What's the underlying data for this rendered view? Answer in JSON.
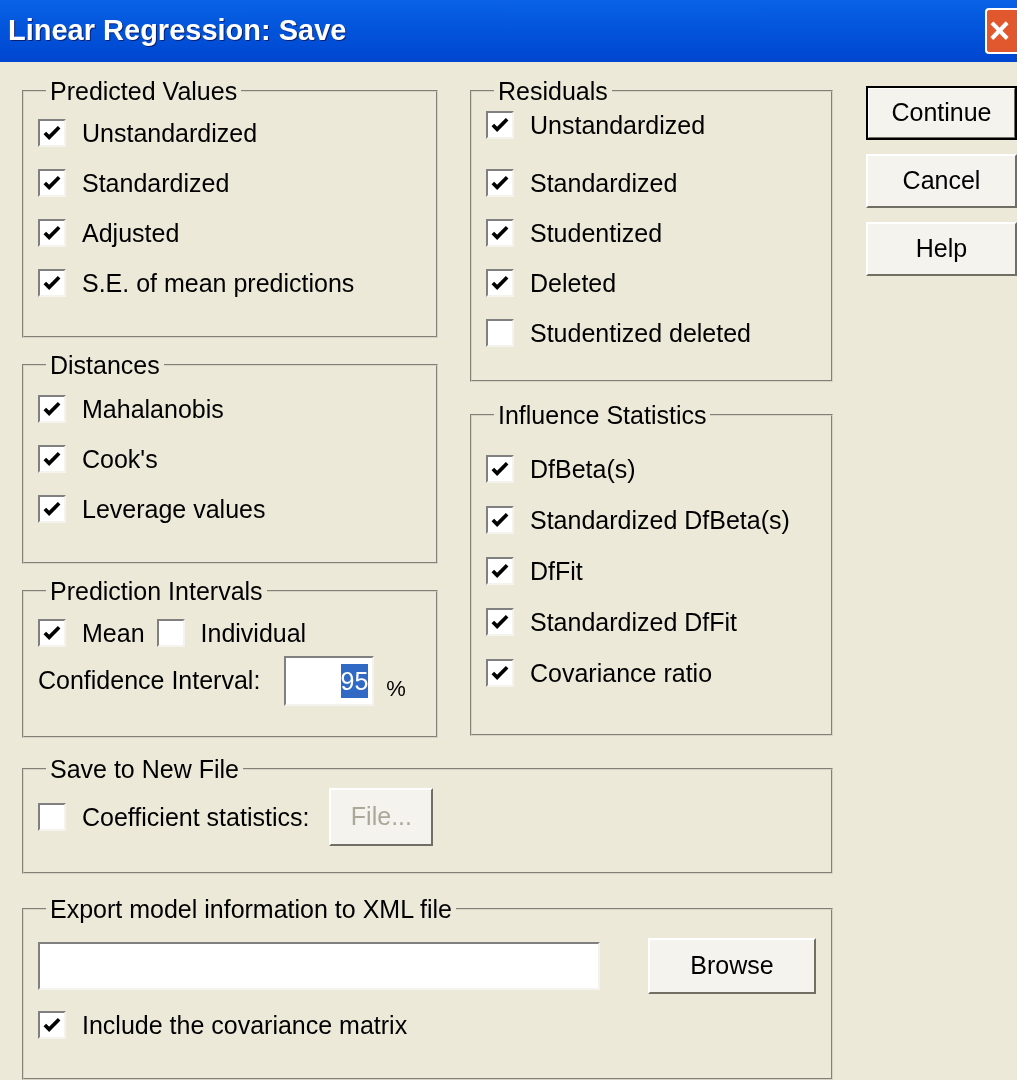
{
  "window": {
    "title": "Linear Regression: Save",
    "close": "×"
  },
  "left_groups": [
    {
      "title": "Predicted Values",
      "items": [
        {
          "label": "Unstandardized",
          "checked": true
        },
        {
          "label": "Standardized",
          "checked": true
        },
        {
          "label": "Adjusted",
          "checked": true
        },
        {
          "label": "S.E. of mean predictions",
          "checked": true
        }
      ]
    },
    {
      "title": "Distances",
      "items": [
        {
          "label": "Mahalanobis",
          "checked": true
        },
        {
          "label": "Cook's",
          "checked": true
        },
        {
          "label": "Leverage values",
          "checked": true
        }
      ]
    }
  ],
  "prediction_intervals": {
    "title": "Prediction Intervals",
    "items": [
      {
        "label": "Mean",
        "checked": true
      },
      {
        "label": "Individual",
        "checked": false
      }
    ],
    "confidence_label": "Confidence Interval:",
    "confidence_value": "95",
    "unit": "%"
  },
  "right_groups": [
    {
      "title": "Residuals",
      "items": [
        {
          "label": "Unstandardized",
          "checked": true
        },
        {
          "label": "Standardized",
          "checked": true
        },
        {
          "label": "Studentized",
          "checked": true
        },
        {
          "label": "Deleted",
          "checked": true
        },
        {
          "label": "Studentized deleted",
          "checked": false
        }
      ]
    },
    {
      "title": "Influence Statistics",
      "items": [
        {
          "label": "DfBeta(s)",
          "checked": true
        },
        {
          "label": "Standardized DfBeta(s)",
          "checked": true
        },
        {
          "label": "DfFit",
          "checked": true
        },
        {
          "label": "Standardized DfFit",
          "checked": true
        },
        {
          "label": "Covariance ratio",
          "checked": true
        }
      ]
    }
  ],
  "buttons": [
    {
      "label": "Continue",
      "default": true
    },
    {
      "label": "Cancel",
      "default": false
    },
    {
      "label": "Help",
      "default": false
    }
  ],
  "save_to_new_file": {
    "title": "Save to New File",
    "item": {
      "label": "Coefficient statistics:",
      "checked": false
    },
    "button": {
      "label": "File...",
      "disabled": true
    }
  },
  "export": {
    "title": "Export model information to XML file",
    "button": "Browse",
    "item": {
      "label": "Include the covariance matrix",
      "checked": true
    }
  }
}
